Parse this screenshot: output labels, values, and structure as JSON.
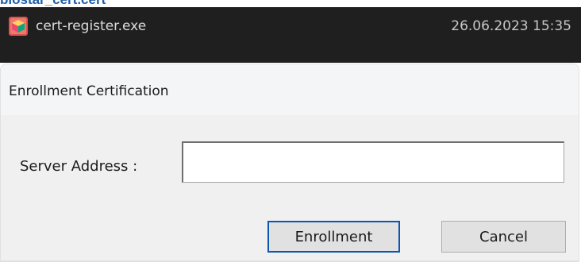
{
  "page": {
    "heading": "biostar_cert.cert"
  },
  "file_row": {
    "icon": "app-cube-icon",
    "name": "cert-register.exe",
    "date": "26.06.2023 15:35"
  },
  "dialog": {
    "title": "Enrollment Certification",
    "server_label": "Server Address :",
    "server_value": "",
    "enroll_label": "Enrollment",
    "cancel_label": "Cancel"
  },
  "colors": {
    "file_row_bg": "#1f1f1f",
    "dialog_bg": "#f0f0f0",
    "primary_button_border": "#0b58b2",
    "heading": "#1f5fa8"
  }
}
